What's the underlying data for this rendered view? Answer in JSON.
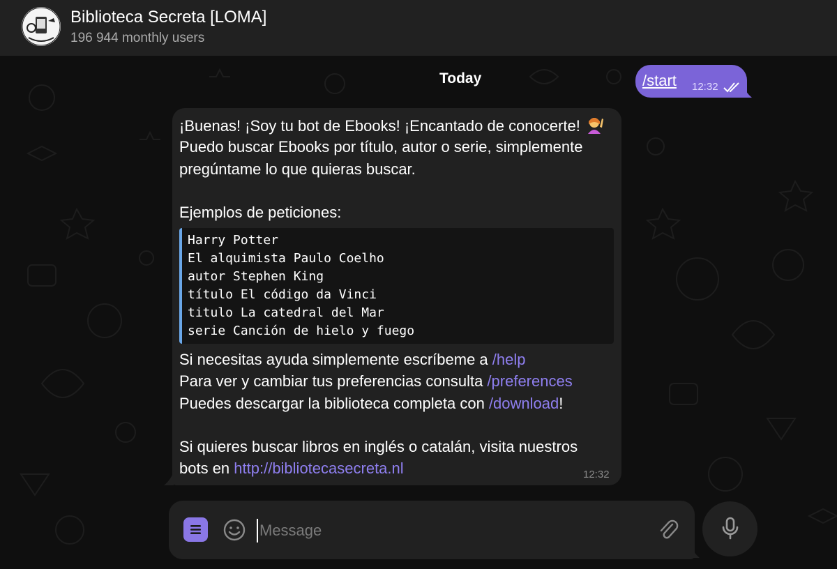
{
  "header": {
    "title": "Biblioteca Secreta [LOMA]",
    "subtitle": "196 944 monthly users",
    "avatar_icon": "bot-avatar-icon"
  },
  "chat": {
    "date_separator": "Today",
    "outgoing": {
      "text": "/start",
      "time": "12:32",
      "status_icon": "double-check-icon"
    },
    "incoming": {
      "lines": [
        "¡Buenas! ¡Soy tu bot de Ebooks! ¡Encantado de conocerte!",
        "Puedo buscar Ebooks por título, autor o serie, simplemente",
        "pregúntame lo que quieras buscar.",
        "",
        "Ejemplos de peticiones:"
      ],
      "emoji": "🙋‍♀️",
      "code_lines": [
        "Harry Potter",
        "El alquimista Paulo Coelho",
        "autor Stephen King",
        "título El código da Vinci",
        "titulo La catedral del Mar",
        "serie Canción de hielo y fuego"
      ],
      "help_text": "Si necesitas ayuda simplemente escríbeme a ",
      "help_link": "/help",
      "prefs_text": "Para ver y cambiar tus preferencias consulta ",
      "prefs_link": "/preferences",
      "download_text": "Puedes descargar la biblioteca completa con ",
      "download_link": "/download",
      "download_suffix": "!",
      "bots_text_1": "Si quieres buscar libros en inglés o catalán, visita nuestros",
      "bots_text_2": "bots en ",
      "site_link": "http://bibliotecasecreta.nl",
      "time": "12:32"
    }
  },
  "composer": {
    "placeholder": "Message",
    "value": ""
  },
  "colors": {
    "accent": "#7b64d8",
    "link": "#8f7ff0",
    "bubble_in": "#212121",
    "header_bg": "#212121",
    "code_border": "#6aa7e8"
  }
}
